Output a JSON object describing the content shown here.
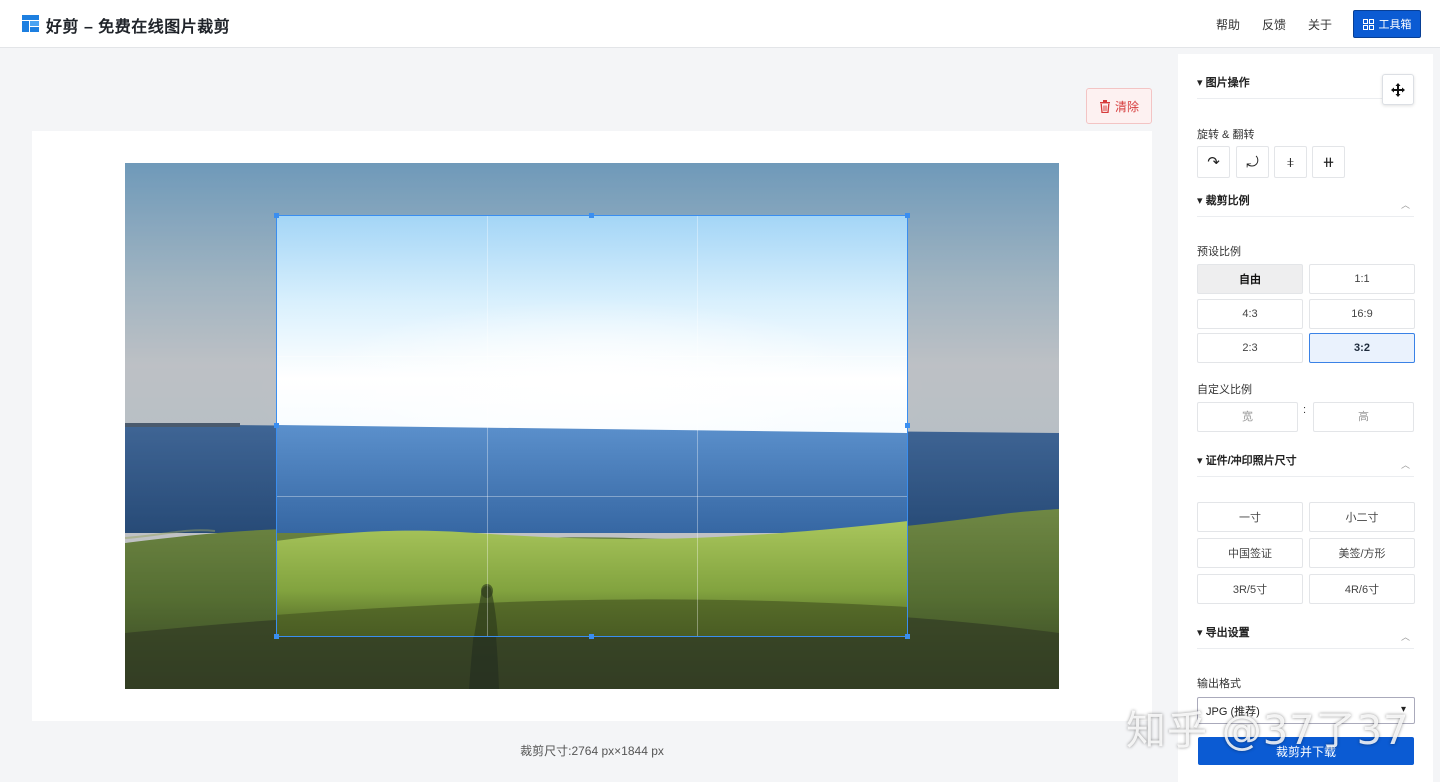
{
  "header": {
    "title": "好剪 – 免费在线图片裁剪",
    "nav": [
      "帮助",
      "反馈",
      "关于"
    ],
    "toolbox_label": "工具箱",
    "logo_icon": "grid-logo-icon",
    "accent_color": "#0b5bd3"
  },
  "workspace": {
    "clear_label": "清除",
    "crop_info": "裁剪尺寸:2764 px×1844 px"
  },
  "sidebar": {
    "image_ops": {
      "title": "▾ 图片操作",
      "rotate_label": "旋转 & 翻转",
      "buttons": [
        "rotate-right-icon",
        "rotate-left-icon",
        "flip-vertical-icon",
        "flip-horizontal-icon"
      ]
    },
    "crop_ratio": {
      "title": "▾ 裁剪比例",
      "preset_label": "预设比例",
      "presets": [
        "自由",
        "1:1",
        "4:3",
        "16:9",
        "2:3",
        "3:2"
      ],
      "selected": "3:2",
      "custom_label": "自定义比例",
      "width_placeholder": "宽",
      "height_placeholder": "高",
      "separator": ":"
    },
    "photo_sizes": {
      "title": "▾ 证件/冲印照片尺寸",
      "options": [
        "一寸",
        "小二寸",
        "中国签证",
        "美签/方形",
        "3R/5寸",
        "4R/6寸"
      ]
    },
    "export": {
      "title": "▾ 导出设置",
      "format_label": "输出格式",
      "format_value": "JPG (推荐)",
      "download_label": "裁剪并下载"
    }
  },
  "watermark": "知乎 @37了37"
}
